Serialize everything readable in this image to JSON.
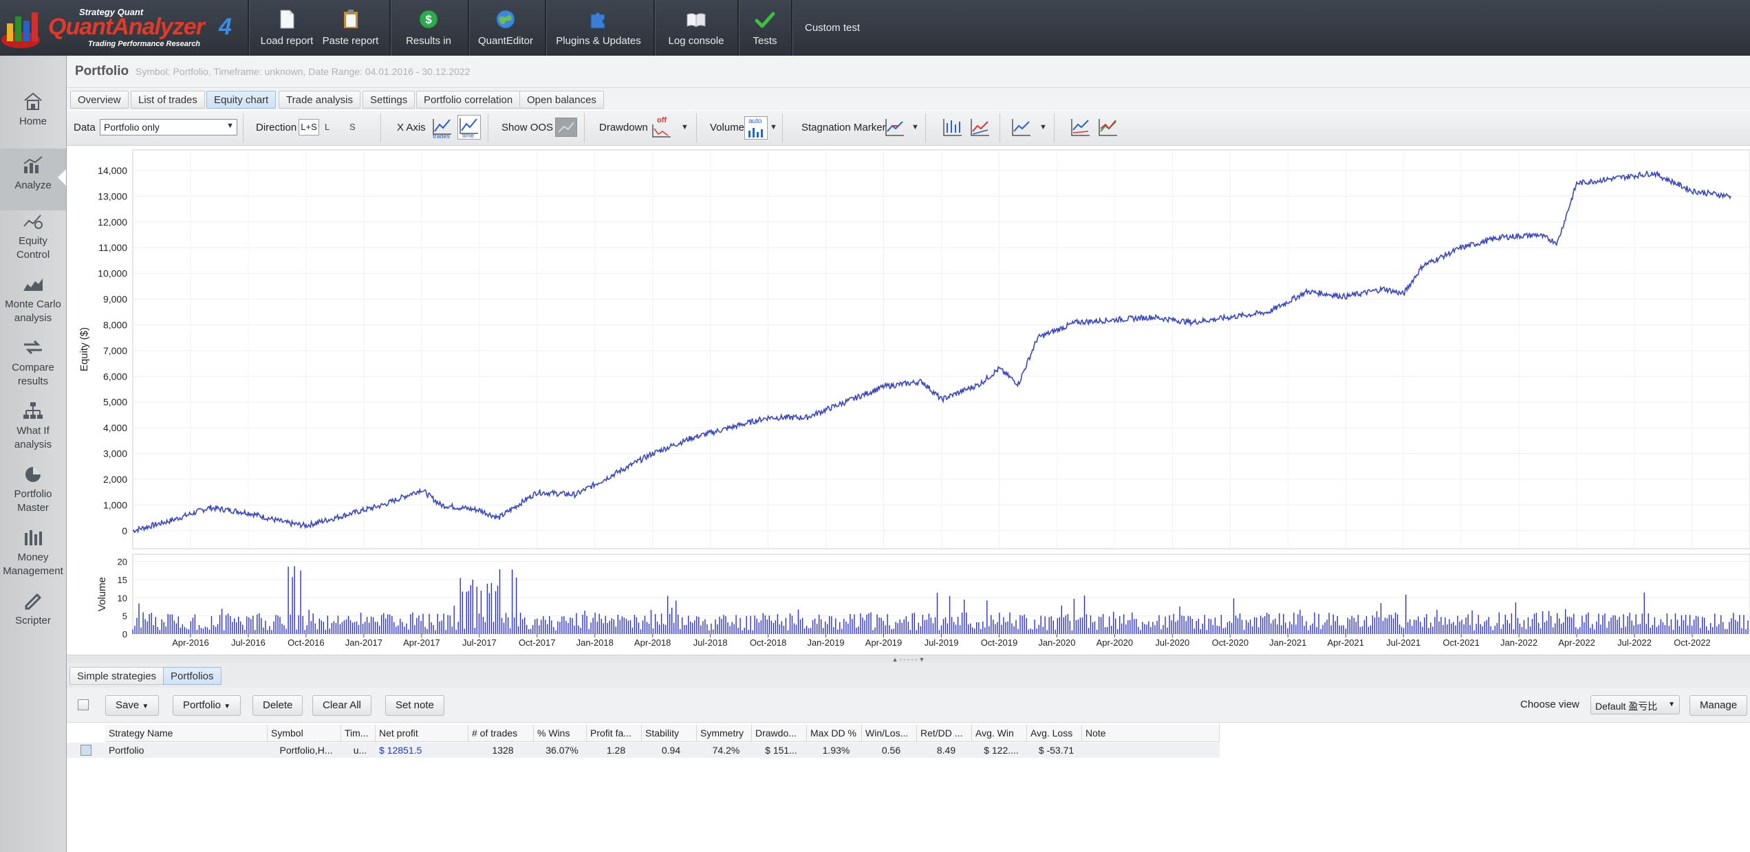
{
  "app": {
    "logo_brand": "Strategy Quant",
    "logo_name": "QuantAnalyzer",
    "logo_version": "4",
    "logo_tagline": "Trading Performance Research"
  },
  "toolbar": {
    "buttons": [
      {
        "label": "Load report",
        "icon": "document-icon"
      },
      {
        "label": "Paste report",
        "icon": "clipboard-icon"
      },
      {
        "label": "Results in",
        "icon": "dollar-coin-icon"
      },
      {
        "label": "QuantEditor",
        "icon": "globe-icon"
      },
      {
        "label": "Plugins & Updates",
        "icon": "puzzle-icon"
      },
      {
        "label": "Log console",
        "icon": "book-icon"
      },
      {
        "label": "Tests",
        "icon": "checkmark-icon"
      }
    ],
    "custom_test": "Custom test"
  },
  "sidebar": {
    "items": [
      {
        "label": "Home",
        "icon": "home-icon"
      },
      {
        "label": "Analyze",
        "icon": "analyze-icon",
        "active": true
      },
      {
        "label": "Equity Control",
        "icon": "equity-control-icon"
      },
      {
        "label": "Monte Carlo analysis",
        "icon": "monte-carlo-icon"
      },
      {
        "label": "Compare results",
        "icon": "compare-icon"
      },
      {
        "label": "What If analysis",
        "icon": "what-if-icon"
      },
      {
        "label": "Portfolio Master",
        "icon": "pie-icon"
      },
      {
        "label": "Money Management",
        "icon": "money-icon"
      },
      {
        "label": "Scripter",
        "icon": "pen-icon"
      }
    ]
  },
  "header": {
    "title": "Portfolio",
    "subtitle": "Symbol: Portfolio, Timeframe: unknown, Date Range: 04.01.2016 - 30.12.2022"
  },
  "tabs": [
    "Overview",
    "List of trades",
    "Equity chart",
    "Trade analysis",
    "Settings",
    "Portfolio correlation",
    "Open balances"
  ],
  "active_tab": "Equity chart",
  "controls": {
    "data_label": "Data",
    "data_value": "Portfolio only",
    "direction_label": "Direction",
    "direction_options": [
      "L+S",
      "L",
      "S"
    ],
    "direction_selected": "L+S",
    "xaxis_label": "X Axis",
    "xaxis_options": [
      "trades",
      "time"
    ],
    "xaxis_selected": "time",
    "show_oos_label": "Show OOS",
    "drawdown_label": "Drawdown",
    "drawdown_value": "off",
    "volume_label": "Volume",
    "volume_value": "auto",
    "stagnation_label": "Stagnation Marker"
  },
  "chart_data": [
    {
      "type": "line",
      "ylabel": "Equity ($)",
      "ylim": [
        -700,
        14800
      ],
      "yticks": [
        "0",
        "1,000",
        "2,000",
        "3,000",
        "4,000",
        "5,000",
        "6,000",
        "7,000",
        "8,000",
        "9,000",
        "10,000",
        "11,000",
        "12,000",
        "13,000",
        "14,000"
      ],
      "color": "#3b47b8",
      "grid": true,
      "series": [
        {
          "x": [
            "2016-01",
            "2016-03",
            "2016-05",
            "2016-07",
            "2016-09",
            "2016-10",
            "2016-12",
            "2017-02",
            "2017-04",
            "2017-05",
            "2017-07",
            "2017-08",
            "2017-10",
            "2017-12",
            "2018-02",
            "2018-04",
            "2018-06",
            "2018-08",
            "2018-10",
            "2018-12",
            "2019-02",
            "2019-04",
            "2019-06",
            "2019-07",
            "2019-09",
            "2019-10",
            "2019-11",
            "2019-12",
            "2020-02",
            "2020-04",
            "2020-06",
            "2020-08",
            "2020-10",
            "2020-12",
            "2021-02",
            "2021-04",
            "2021-06",
            "2021-07",
            "2021-08",
            "2021-10",
            "2021-12",
            "2022-02",
            "2022-03",
            "2022-04",
            "2022-06",
            "2022-08",
            "2022-10",
            "2022-12"
          ],
          "y": [
            0,
            400,
            900,
            700,
            300,
            200,
            600,
            1000,
            1600,
            1000,
            800,
            500,
            1500,
            1400,
            2200,
            3000,
            3600,
            4000,
            4400,
            4400,
            5000,
            5600,
            5800,
            5100,
            5700,
            6300,
            5700,
            7500,
            8100,
            8200,
            8300,
            8100,
            8300,
            8500,
            9300,
            9100,
            9400,
            9200,
            10300,
            11000,
            11400,
            11500,
            11200,
            13500,
            13700,
            13900,
            13200,
            13000
          ]
        }
      ]
    },
    {
      "type": "bar",
      "ylabel": "Volume",
      "ylim": [
        0,
        22
      ],
      "yticks": [
        "0",
        "5",
        "10",
        "15",
        "20"
      ],
      "color": "#2a2fd0",
      "xticks": [
        "Apr-2016",
        "Jul-2016",
        "Oct-2016",
        "Jan-2017",
        "Apr-2017",
        "Jul-2017",
        "Oct-2017",
        "Jan-2018",
        "Apr-2018",
        "Jul-2018",
        "Oct-2018",
        "Jan-2019",
        "Apr-2019",
        "Jul-2019",
        "Oct-2019",
        "Jan-2020",
        "Apr-2020",
        "Jul-2020",
        "Oct-2020",
        "Jan-2021",
        "Apr-2021",
        "Jul-2021",
        "Oct-2021",
        "Jan-2022",
        "Apr-2022",
        "Jul-2022",
        "Oct-2022"
      ],
      "peaks": [
        {
          "x": "2016-09",
          "y": 19
        },
        {
          "x": "2017-06",
          "y": 16
        },
        {
          "x": "2017-07",
          "y": 16
        },
        {
          "x": "2017-08",
          "y": 21
        }
      ]
    }
  ],
  "bottom": {
    "subtabs": [
      "Simple strategies",
      "Portfolios"
    ],
    "active_subtab": "Portfolios",
    "actions": [
      "Save",
      "Portfolio",
      "Delete",
      "Clear All",
      "Set note"
    ],
    "choose_view_label": "Choose view",
    "choose_view_value": "Default 盈亏比",
    "manage_label": "Manage"
  },
  "table": {
    "columns": [
      "Strategy Name",
      "Symbol",
      "Tim...",
      "Net profit",
      "# of trades",
      "% Wins",
      "Profit fa...",
      "Stability",
      "Symmetry",
      "Drawdo...",
      "Max DD %",
      "Win/Los...",
      "Ret/DD ...",
      "Avg. Win",
      "Avg. Loss",
      "Note"
    ],
    "rows": [
      [
        "Portfolio",
        "Portfolio,H...",
        "u...",
        "$ 12851.5",
        "1328",
        "36.07%",
        "1.28",
        "0.94",
        "74.2%",
        "$ 151...",
        "1.93%",
        "0.56",
        "8.49",
        "$ 122....",
        "$ -53.71",
        ""
      ]
    ]
  }
}
